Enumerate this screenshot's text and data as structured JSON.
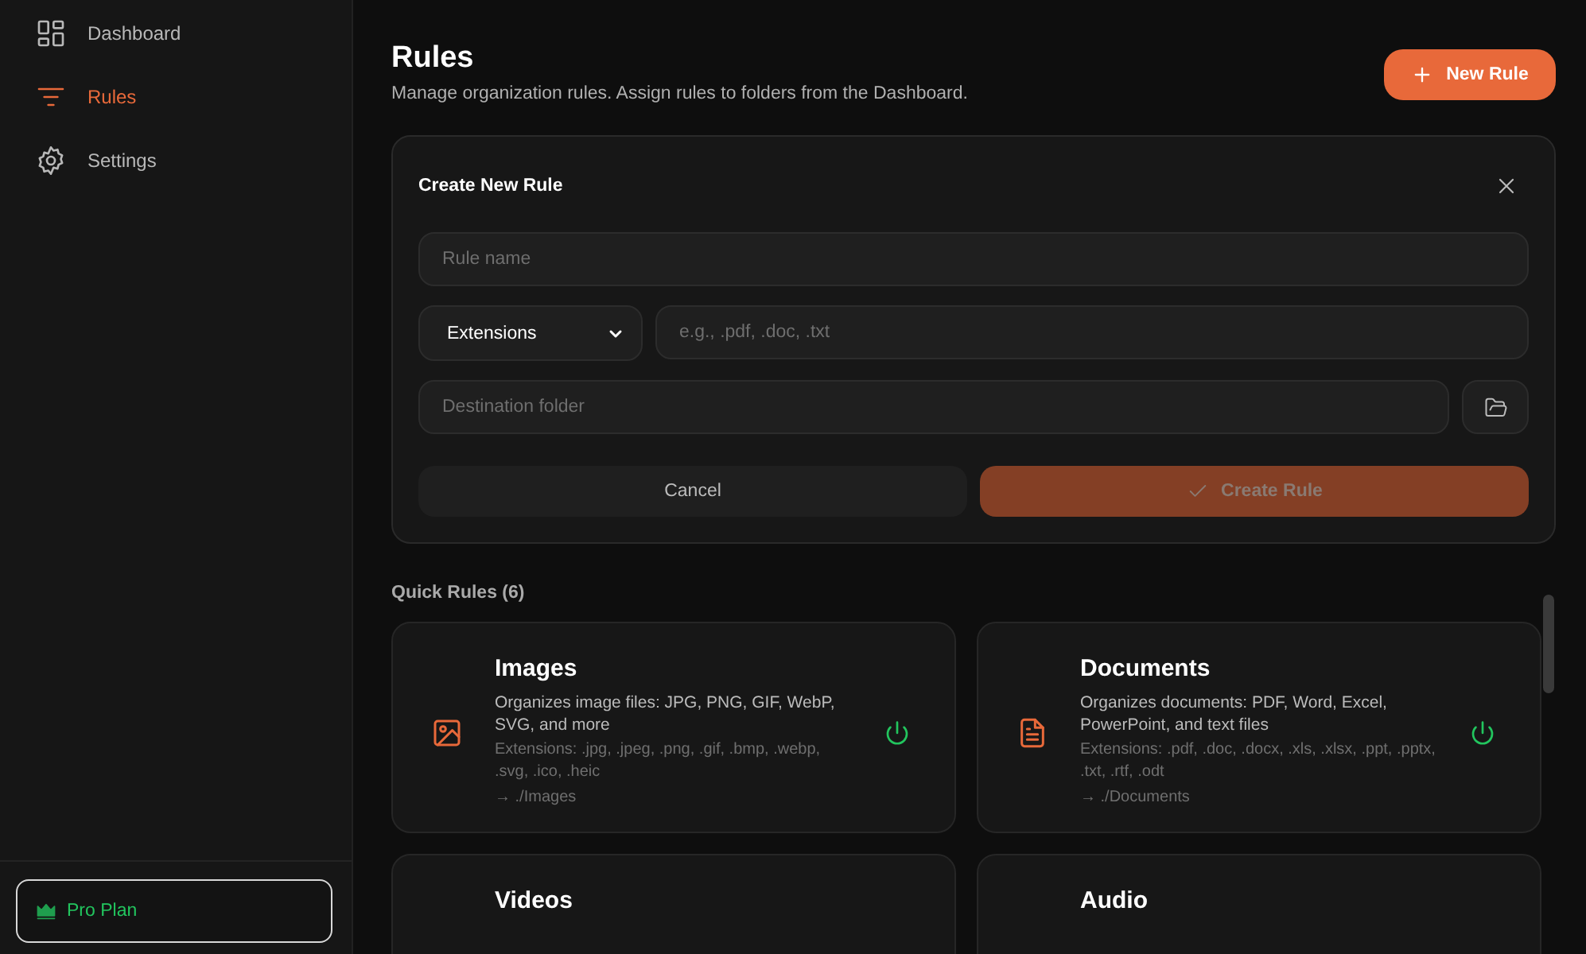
{
  "sidebar": {
    "items": [
      {
        "label": "Dashboard",
        "kind": "grid",
        "selected": false
      },
      {
        "label": "Rules",
        "kind": "filter",
        "selected": true
      },
      {
        "label": "Settings",
        "kind": "gear",
        "selected": false
      }
    ],
    "plan": {
      "label": "Pro Plan"
    }
  },
  "header": {
    "title": "Rules",
    "subtitle": "Manage organization rules. Assign rules to folders from the Dashboard.",
    "new_button": "New Rule"
  },
  "form": {
    "title": "Create New Rule",
    "name_placeholder": "Rule name",
    "type_value": "Extensions",
    "extensions_placeholder": "e.g., .pdf, .doc, .txt",
    "destination_placeholder": "Destination folder",
    "cancel": "Cancel",
    "submit": {
      "label": "Create Rule",
      "disabled": true
    }
  },
  "quick_rules": {
    "heading": "Quick Rules (6)",
    "rules": [
      {
        "title": "Images",
        "kind": "image",
        "description": "Organizes image files: JPG, PNG, GIF, WebP, SVG, and more",
        "extensions": "Extensions: .jpg, .jpeg, .png, .gif, .bmp, .webp, .svg, .ico, .heic",
        "destination": "→ ./Images",
        "enabled": true
      },
      {
        "title": "Documents",
        "kind": "document",
        "description": "Organizes documents: PDF, Word, Excel, PowerPoint, and text files",
        "extensions": "Extensions: .pdf, .doc, .docx, .xls, .xlsx, .ppt, .pptx, .txt, .rtf, .odt",
        "destination": "→ ./Documents",
        "enabled": true
      },
      {
        "title": "Videos"
      },
      {
        "title": "Audio"
      }
    ]
  }
}
